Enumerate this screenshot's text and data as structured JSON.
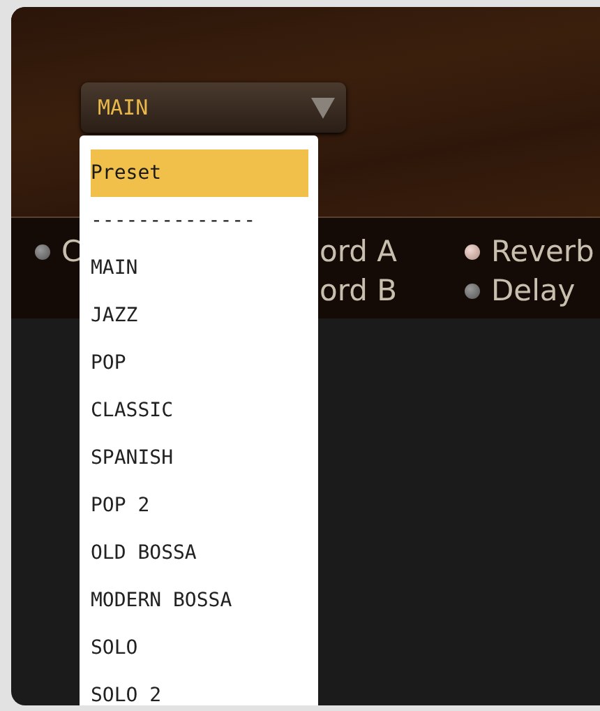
{
  "preset_dropdown": {
    "value": "MAIN"
  },
  "option_rows": [
    {
      "left": {
        "kind": "light",
        "label": "C",
        "on": false
      },
      "middle": {
        "kind": "label",
        "label": "ord A"
      },
      "right": {
        "kind": "light",
        "label": "Reverb",
        "on": true
      }
    },
    {
      "middle": {
        "kind": "label",
        "label": "ord B"
      },
      "right": {
        "kind": "light",
        "label": "Delay",
        "on": false
      }
    }
  ],
  "menu": {
    "items": [
      {
        "label": "Preset",
        "selected": true
      },
      {
        "label": "--------------",
        "selected": false
      },
      {
        "label": "MAIN",
        "selected": false
      },
      {
        "label": "JAZZ",
        "selected": false
      },
      {
        "label": "POP",
        "selected": false
      },
      {
        "label": "CLASSIC",
        "selected": false
      },
      {
        "label": "SPANISH",
        "selected": false
      },
      {
        "label": "POP 2",
        "selected": false
      },
      {
        "label": "OLD BOSSA",
        "selected": false
      },
      {
        "label": "MODERN BOSSA",
        "selected": false
      },
      {
        "label": "SOLO",
        "selected": false
      },
      {
        "label": "SOLO 2",
        "selected": false
      }
    ]
  }
}
